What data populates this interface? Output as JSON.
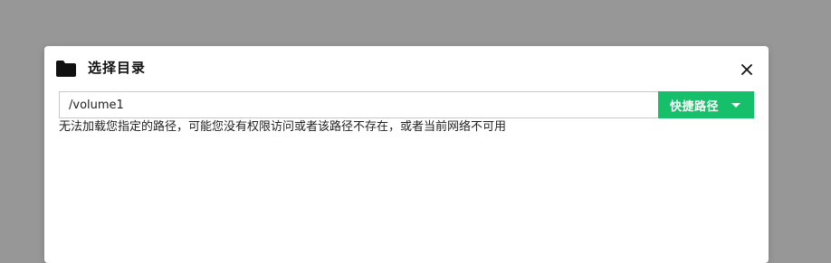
{
  "dialog": {
    "title": "选择目录",
    "icon": "folder-icon",
    "close_icon": "close-icon"
  },
  "path": {
    "value": "/volume1"
  },
  "shortcut": {
    "label": "快捷路径",
    "icon": "caret-down-icon",
    "color": "#16c06a"
  },
  "error": {
    "message": "无法加载您指定的路径，可能您没有权限访问或者该路径不存在，或者当前网络不可用"
  },
  "colors": {
    "overlay": "#979797",
    "dialog_bg": "#ffffff",
    "accent": "#16c06a"
  }
}
